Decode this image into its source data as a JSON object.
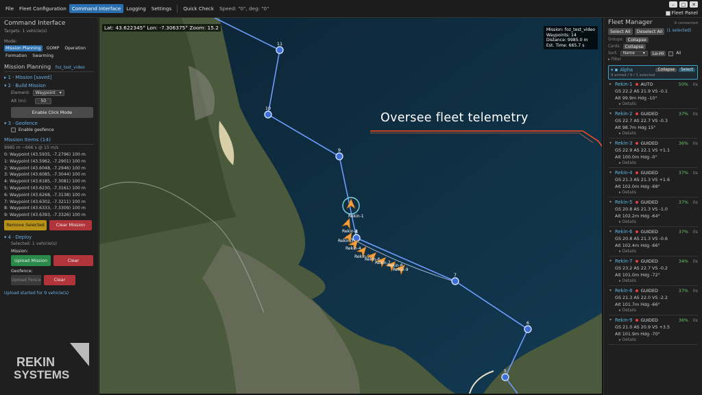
{
  "menu": {
    "items": [
      "File",
      "Fleet Configuration",
      "Command Interface",
      "Logging",
      "Settings"
    ],
    "active": "Command Interface",
    "quick_check": "Quick Check",
    "readout": "Speed: \"0\",  deg: \"0\"",
    "fleet_panel_label": "Fleet Panel"
  },
  "left": {
    "title": "Command Interface",
    "targets": "Targets: 1 vehicle(s)",
    "mode_label": "Mode:",
    "modes": [
      "Mission Planning",
      "GOMP",
      "Operation",
      "Formation",
      "Swarming"
    ],
    "mode_selected": "Mission Planning",
    "planning_title": "Mission Planning",
    "planning_name": "foz_test_video",
    "step1": "1 · Mission",
    "step1_status": "[saved]",
    "step2": "2 · Build Mission",
    "element_label": "Element:",
    "element_value": "Waypoint",
    "alt_label": "Alt (m):",
    "alt_value": "50",
    "click_mode_button": "Enable Click Mode",
    "step3": "3 · Geofence",
    "geofence_checkbox": "Enable geofence",
    "items_title": "Mission Items",
    "items_count": "(14)",
    "items_summary": "9985 m  ~666 s @ 15 m/s",
    "items": [
      "0: Waypoint  (43.5935, -7.2796)  100 m",
      "1: Waypoint  (43.5962, -7.2901)  100 m",
      "2: Waypoint  (43.6048, -7.2946)  100 m",
      "3: Waypoint  (43.6085, -7.3044)  100 m",
      "4: Waypoint  (43.6185, -7.3081)  100 m",
      "5: Waypoint  (43.6230, -7.3161)  100 m",
      "6: Waypoint  (43.6268, -7.3138)  100 m",
      "7: Waypoint  (43.6302, -7.3211)  100 m",
      "8: Waypoint  (43.6333, -7.3309)  100 m",
      "9: Waypoint  (43.6393, -7.3326)  100 m"
    ],
    "remove_selected": "Remove Selected",
    "clear_mission": "Clear Mission",
    "step4": "4 · Deploy",
    "selected": "Selected: 1 vehicle(s)",
    "mission_label": "Mission:",
    "upload_mission": "Upload Mission",
    "clear1": "Clear",
    "geofence_label": "Geofence:",
    "upload_fence": "Upload Fence",
    "clear2": "Clear",
    "upload_status": "Upload started for 9 vehicle(s)",
    "logo_line1": "REKIN",
    "logo_line2": "SYSTEMS"
  },
  "map": {
    "coords": "Lat: 43.622345° Lon: -7.306375° Zoom: 15.2",
    "mission_info": [
      "Mission: foz_test_video",
      "Waypoints: 14",
      "Distance: 9985.0 m",
      "Est. Time: 665.7 s"
    ],
    "overlay_text": "Oversee fleet telemetry",
    "waypoint_labels": [
      "11",
      "10",
      "9",
      "8",
      "7",
      "6",
      "5"
    ],
    "vehicle_labels": [
      "Rekin-1",
      "Rekin-2",
      "Rekin-3",
      "Rekin-4",
      "Rekin-5",
      "Rekin-6",
      "Rekin-7",
      "Rekin-8",
      "Rekin-9"
    ]
  },
  "right": {
    "title": "Fleet Manager",
    "connected": "9 connected",
    "select_all": "Select All",
    "deselect_all": "Deselect All",
    "selected_count": "(1 selected)",
    "groups_label": "Groups:",
    "groups_collapse": "Collapse",
    "cards_label": "Cards:",
    "cards_collapse": "Collapse",
    "sort_label": "Sort:",
    "sort_value": "Name",
    "sort_order": "Lo-Hi",
    "all_label": "All",
    "filter_label": "Filter",
    "group_name": "Alpha",
    "group_collapse": "Collapse",
    "group_select": "Select",
    "group_summary": "9 armed / 9 / 1 selected",
    "details_label": "Details",
    "vehicles": [
      {
        "name": "Rekin-1",
        "mode": "AUTO",
        "pct": "50%",
        "sig": "0s",
        "gs": "22.2",
        "as": "21.9",
        "vs": "-0.1",
        "alt": "99.9m",
        "hdg": "-10°"
      },
      {
        "name": "Rekin-2",
        "mode": "GUIDED",
        "pct": "37%",
        "sig": "0s",
        "gs": "22.7",
        "as": "22.7",
        "vs": "-0.3",
        "alt": "98.7m",
        "hdg": "15°"
      },
      {
        "name": "Rekin-3",
        "mode": "GUIDED",
        "pct": "36%",
        "sig": "0s",
        "gs": "22.9",
        "as": "22.1",
        "vs": "+1.1",
        "alt": "100.0m",
        "hdg": "-0°"
      },
      {
        "name": "Rekin-4",
        "mode": "GUIDED",
        "pct": "37%",
        "sig": "0s",
        "gs": "21.3",
        "as": "21.3",
        "vs": "+1.6",
        "alt": "102.0m",
        "hdg": "-68°"
      },
      {
        "name": "Rekin-5",
        "mode": "GUIDED",
        "pct": "37%",
        "sig": "0s",
        "gs": "20.8",
        "as": "21.3",
        "vs": "-1.0",
        "alt": "102.2m",
        "hdg": "-64°"
      },
      {
        "name": "Rekin-6",
        "mode": "GUIDED",
        "pct": "37%",
        "sig": "0s",
        "gs": "20.8",
        "as": "21.3",
        "vs": "-0.6",
        "alt": "102.4m",
        "hdg": "-66°"
      },
      {
        "name": "Rekin-7",
        "mode": "GUIDED",
        "pct": "34%",
        "sig": "0s",
        "gs": "23.2",
        "as": "22.7",
        "vs": "-0.2",
        "alt": "101.0m",
        "hdg": "-72°"
      },
      {
        "name": "Rekin-8",
        "mode": "GUIDED",
        "pct": "37%",
        "sig": "0s",
        "gs": "21.3",
        "as": "22.0",
        "vs": "-2.2",
        "alt": "101.7m",
        "hdg": "-66°"
      },
      {
        "name": "Rekin-9",
        "mode": "GUIDED",
        "pct": "36%",
        "sig": "0s",
        "gs": "21.0",
        "as": "20.9",
        "vs": "+3.5",
        "alt": "101.9m",
        "hdg": "-70°"
      }
    ]
  },
  "colors": {
    "accent": "#2a6fb0",
    "route": "#6e9cff",
    "overlay_line": "#ff4a1a",
    "sea": "#0d2a3c",
    "land": "#4a5a3a"
  }
}
